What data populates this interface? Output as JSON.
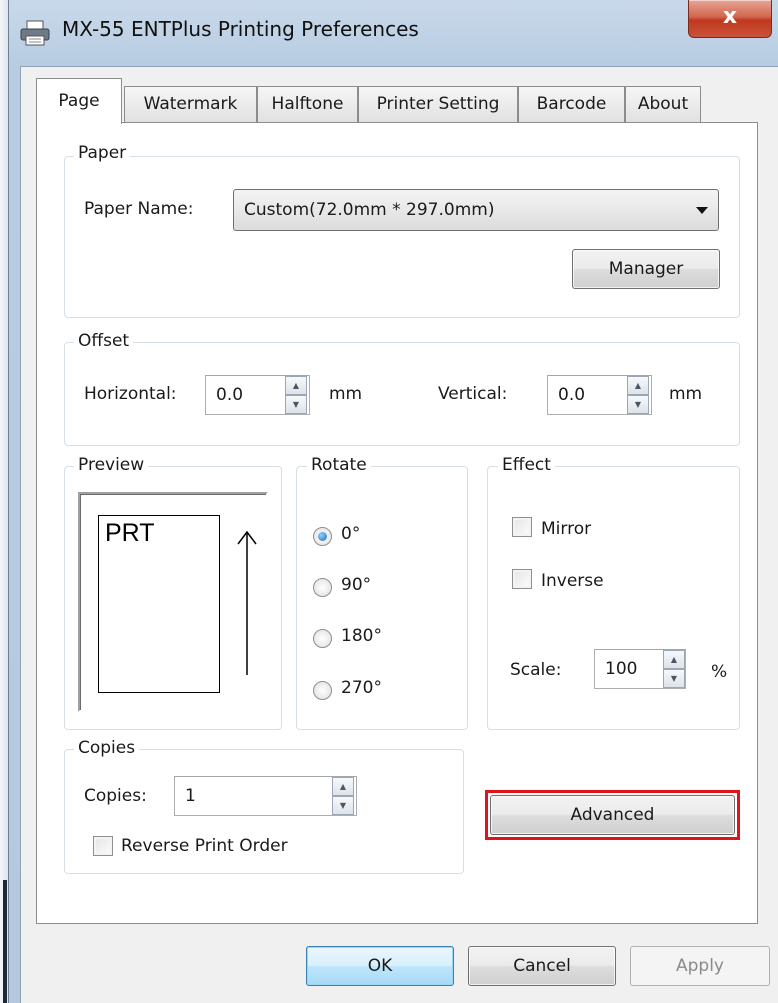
{
  "window": {
    "title": "MX-55 ENTPlus Printing Preferences",
    "close_glyph": "x"
  },
  "tabs": [
    {
      "label": "Page",
      "active": true
    },
    {
      "label": "Watermark",
      "active": false
    },
    {
      "label": "Halftone",
      "active": false
    },
    {
      "label": "Printer Setting",
      "active": false
    },
    {
      "label": "Barcode",
      "active": false
    },
    {
      "label": "About",
      "active": false
    }
  ],
  "paper": {
    "group_label": "Paper",
    "name_label": "Paper Name:",
    "selected": "Custom(72.0mm * 297.0mm)",
    "manager_label": "Manager"
  },
  "offset": {
    "group_label": "Offset",
    "horizontal_label": "Horizontal:",
    "horizontal_value": "0.0",
    "vertical_label": "Vertical:",
    "vertical_value": "0.0",
    "unit": "mm"
  },
  "preview": {
    "group_label": "Preview",
    "text": "PRT"
  },
  "rotate": {
    "group_label": "Rotate",
    "options": [
      "0°",
      "90°",
      "180°",
      "270°"
    ],
    "selected": "0°"
  },
  "effect": {
    "group_label": "Effect",
    "mirror_label": "Mirror",
    "mirror_checked": false,
    "inverse_label": "Inverse",
    "inverse_checked": false,
    "scale_label": "Scale:",
    "scale_value": "100",
    "scale_unit": "%"
  },
  "copies": {
    "group_label": "Copies",
    "copies_label": "Copies:",
    "copies_value": "1",
    "reverse_label": "Reverse Print Order",
    "reverse_checked": false
  },
  "advanced_label": "Advanced",
  "highlight_color": "#e0121b",
  "footer": {
    "ok_label": "OK",
    "cancel_label": "Cancel",
    "apply_label": "Apply",
    "apply_enabled": false
  }
}
